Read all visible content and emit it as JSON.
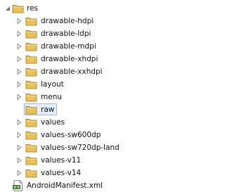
{
  "tree": {
    "root": {
      "label": "res",
      "expanded": true,
      "icon": "folder-icon"
    },
    "folders": [
      {
        "label": "drawable-hdpi"
      },
      {
        "label": "drawable-ldpi"
      },
      {
        "label": "drawable-mdpi"
      },
      {
        "label": "drawable-xhdpi"
      },
      {
        "label": "drawable-xxhdpi"
      },
      {
        "label": "layout"
      },
      {
        "label": "menu"
      },
      {
        "label": "raw",
        "selected": true
      },
      {
        "label": "values"
      },
      {
        "label": "values-sw600dp"
      },
      {
        "label": "values-sw720dp-land"
      },
      {
        "label": "values-v11"
      },
      {
        "label": "values-v14"
      }
    ],
    "file": {
      "label": "AndroidManifest.xml",
      "icon": "xml-file-icon"
    }
  },
  "colors": {
    "folder": "#e8c15a",
    "folder_dark": "#b58a24",
    "selection_bg": "#e4effa",
    "selection_border": "#9dbbd6",
    "arrow": "#8a8a8a"
  }
}
